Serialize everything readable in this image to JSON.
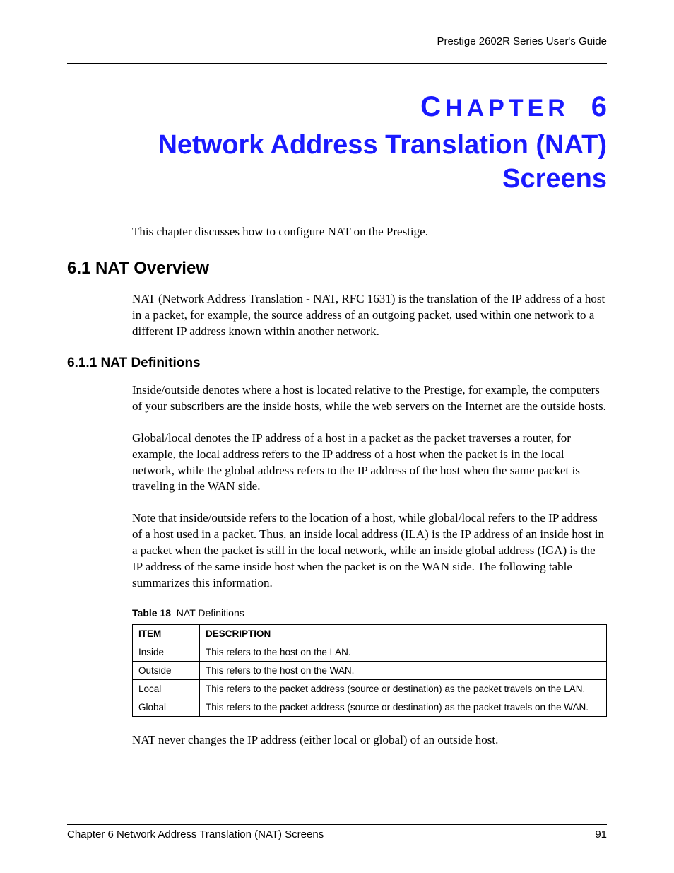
{
  "header": {
    "guide_title": "Prestige 2602R Series User's Guide"
  },
  "chapter": {
    "label_prefix": "C",
    "label_rest": "HAPTER",
    "number": "6",
    "title": "Network Address Translation (NAT) Screens"
  },
  "intro": "This chapter discusses how to configure NAT on the Prestige.",
  "sections": {
    "s6_1": {
      "heading": "6.1  NAT Overview",
      "p1": "NAT (Network Address Translation - NAT, RFC 1631) is the translation of the IP address of a host in a packet, for example, the source address of an outgoing packet, used within one network to a different IP address known within another network."
    },
    "s6_1_1": {
      "heading": "6.1.1  NAT Definitions",
      "p1": "Inside/outside denotes where a host is located relative to the Prestige, for example, the computers of your subscribers are the inside hosts, while the web servers on the Internet are the outside hosts.",
      "p2": "Global/local denotes the IP address of a host in a packet as the packet traverses a router, for example, the local address refers to the IP address of a host when the packet is in the local network, while the global address refers to the IP address of the host when the same packet is traveling in the WAN side.",
      "p3": "Note that inside/outside refers to the location of a host, while global/local refers to the IP address of a host used in a packet. Thus, an inside local address (ILA) is the IP address of an inside host in a packet when the packet is still in the local network, while an inside global address (IGA) is the IP address of the same inside host when the packet is on the WAN side. The following table summarizes this information.",
      "p_after": "NAT never changes the IP address (either local or global) of an outside host."
    }
  },
  "table": {
    "caption_label": "Table 18",
    "caption_text": "NAT Definitions",
    "headers": {
      "col1": "ITEM",
      "col2": "DESCRIPTION"
    },
    "rows": [
      {
        "item": "Inside",
        "desc": "This refers to the host on the LAN."
      },
      {
        "item": "Outside",
        "desc": "This refers to the host on the WAN."
      },
      {
        "item": "Local",
        "desc": "This refers to the packet address (source or destination) as the packet travels on the LAN."
      },
      {
        "item": "Global",
        "desc": "This refers to the packet address (source or destination) as the packet travels on the WAN."
      }
    ]
  },
  "footer": {
    "left": "Chapter 6 Network Address Translation (NAT) Screens",
    "right": "91"
  }
}
